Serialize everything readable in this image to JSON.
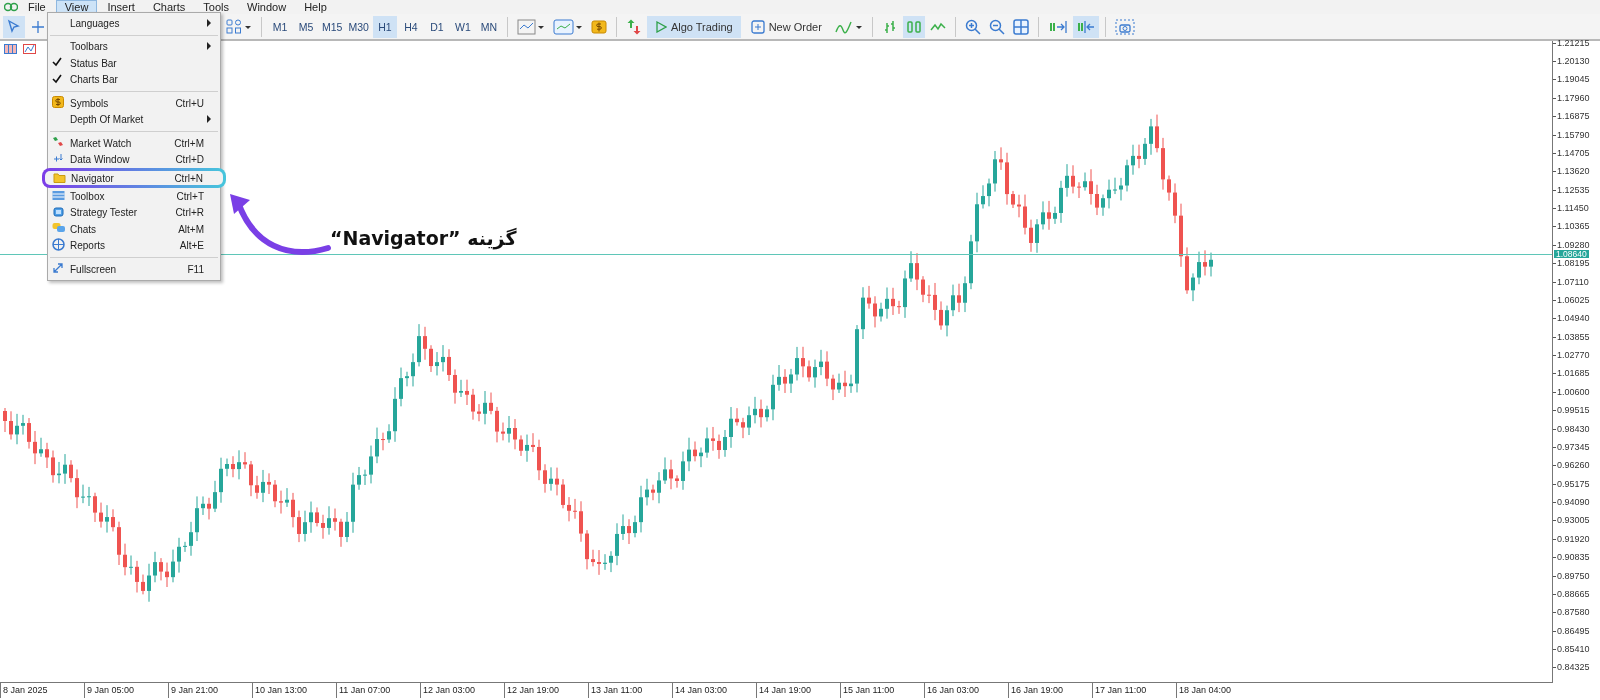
{
  "menubar": [
    {
      "label": "File",
      "selected": false
    },
    {
      "label": "View",
      "selected": true
    },
    {
      "label": "Insert",
      "selected": false
    },
    {
      "label": "Charts",
      "selected": false
    },
    {
      "label": "Tools",
      "selected": false
    },
    {
      "label": "Window",
      "selected": false
    },
    {
      "label": "Help",
      "selected": false
    }
  ],
  "view_menu": [
    {
      "kind": "plain",
      "label": "Languages",
      "submenu": true,
      "checked": false,
      "circled": false
    },
    {
      "kind": "separator"
    },
    {
      "kind": "plain",
      "label": "Toolbars",
      "submenu": true,
      "checked": false,
      "circled": false
    },
    {
      "kind": "plain",
      "label": "Status Bar",
      "submenu": false,
      "checked": true,
      "circled": false
    },
    {
      "kind": "plain",
      "label": "Charts Bar",
      "submenu": false,
      "checked": true,
      "circled": false
    },
    {
      "kind": "separator"
    },
    {
      "kind": "symbols",
      "label": "Symbols",
      "shortcut": "Ctrl+U",
      "submenu": false,
      "checked": false,
      "circled": false
    },
    {
      "kind": "plain",
      "label": "Depth Of Market",
      "submenu": true,
      "checked": false,
      "circled": false
    },
    {
      "kind": "separator"
    },
    {
      "kind": "market",
      "label": "Market Watch",
      "shortcut": "Ctrl+M",
      "submenu": false,
      "checked": false,
      "circled": false
    },
    {
      "kind": "data",
      "label": "Data Window",
      "shortcut": "Ctrl+D",
      "submenu": false,
      "checked": false,
      "circled": false
    },
    {
      "kind": "folder",
      "label": "Navigator",
      "shortcut": "Ctrl+N",
      "submenu": false,
      "checked": false,
      "circled": true
    },
    {
      "kind": "toolbox",
      "label": "Toolbox",
      "shortcut": "Ctrl+T",
      "submenu": false,
      "checked": false,
      "circled": false
    },
    {
      "kind": "tester",
      "label": "Strategy Tester",
      "shortcut": "Ctrl+R",
      "submenu": false,
      "checked": false,
      "circled": false
    },
    {
      "kind": "chats",
      "label": "Chats",
      "shortcut": "Alt+M",
      "submenu": false,
      "checked": false,
      "circled": false
    },
    {
      "kind": "reports",
      "label": "Reports",
      "shortcut": "Alt+E",
      "submenu": false,
      "checked": false,
      "circled": false
    },
    {
      "kind": "separator"
    },
    {
      "kind": "fullscreen",
      "label": "Fullscreen",
      "shortcut": "F11",
      "submenu": false,
      "checked": false,
      "circled": false
    }
  ],
  "toolbar": [
    {
      "kind": "cursor",
      "selected": true
    },
    {
      "kind": "crosshair",
      "selected": false
    },
    {
      "kind": "hidden"
    },
    {
      "kind": "objects",
      "selected": false
    },
    {
      "kind": "sep"
    },
    {
      "kind": "timeframe",
      "label": "M1",
      "selected": false
    },
    {
      "kind": "timeframe",
      "label": "M5",
      "selected": false
    },
    {
      "kind": "timeframe",
      "label": "M15",
      "selected": false
    },
    {
      "kind": "timeframe",
      "label": "M30",
      "selected": false
    },
    {
      "kind": "timeframe",
      "label": "H1",
      "selected": true
    },
    {
      "kind": "timeframe",
      "label": "H4",
      "selected": false
    },
    {
      "kind": "timeframe",
      "label": "D1",
      "selected": false
    },
    {
      "kind": "timeframe",
      "label": "W1",
      "selected": false
    },
    {
      "kind": "timeframe",
      "label": "MN",
      "selected": false
    },
    {
      "kind": "sep"
    },
    {
      "kind": "charttype",
      "selected": false
    },
    {
      "kind": "template",
      "selected": false
    },
    {
      "kind": "symbols",
      "selected": false
    },
    {
      "kind": "sep"
    },
    {
      "kind": "trade",
      "selected": false
    },
    {
      "kind": "algo",
      "label": "Algo Trading",
      "selected": true
    },
    {
      "kind": "order",
      "label": "New Order",
      "selected": false
    },
    {
      "kind": "indicators",
      "selected": false
    },
    {
      "kind": "sep"
    },
    {
      "kind": "bars",
      "selected": false
    },
    {
      "kind": "candles",
      "selected": true
    },
    {
      "kind": "line",
      "selected": false
    },
    {
      "kind": "sep"
    },
    {
      "kind": "zoomin",
      "selected": false
    },
    {
      "kind": "zoomout",
      "selected": false
    },
    {
      "kind": "tile",
      "selected": false
    },
    {
      "kind": "sep"
    },
    {
      "kind": "autoscroll",
      "selected": false
    },
    {
      "kind": "shift",
      "selected": true
    },
    {
      "kind": "sep"
    },
    {
      "kind": "screenshot",
      "selected": false
    }
  ],
  "chart": {
    "current_price": "1.08640",
    "price_axis": [
      "1.21215",
      "1.20130",
      "1.19045",
      "1.17960",
      "1.16875",
      "1.15790",
      "1.14705",
      "1.13620",
      "1.12535",
      "1.11450",
      "1.10365",
      "1.09280",
      "1.08195",
      "1.07110",
      "1.06025",
      "1.04940",
      "1.03855",
      "1.02770",
      "1.01685",
      "1.00600",
      "0.99515",
      "0.98430",
      "0.97345",
      "0.96260",
      "0.95175",
      "0.94090",
      "0.93005",
      "0.91920",
      "0.90835",
      "0.89750",
      "0.88665",
      "0.87580",
      "0.86495",
      "0.85410",
      "0.84325"
    ],
    "time_axis": [
      "8 Jan 2025",
      "9 Jan 05:00",
      "9 Jan 21:00",
      "10 Jan 13:00",
      "11 Jan 07:00",
      "12 Jan 03:00",
      "12 Jan 19:00",
      "13 Jan 11:00",
      "14 Jan 03:00",
      "14 Jan 19:00",
      "15 Jan 11:00",
      "16 Jan 03:00",
      "16 Jan 19:00",
      "17 Jan 11:00",
      "18 Jan 04:00"
    ]
  },
  "annotation": {
    "label": "گزینه ”Navigator“"
  }
}
